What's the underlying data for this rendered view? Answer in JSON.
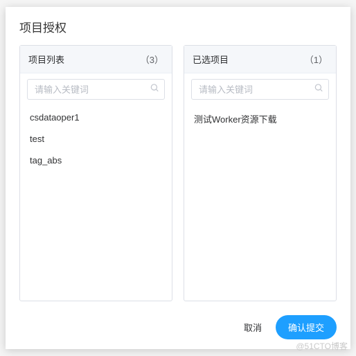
{
  "modal": {
    "title": "项目授权"
  },
  "panels": {
    "available": {
      "title": "项目列表",
      "count": "（3）",
      "search_placeholder": "请输入关键词",
      "items": [
        {
          "label": "csdataoper1"
        },
        {
          "label": "test"
        },
        {
          "label": "tag_abs"
        }
      ]
    },
    "selected": {
      "title": "已选项目",
      "count": "（1）",
      "search_placeholder": "请输入关键词",
      "items": [
        {
          "label": "测试Worker资源下载"
        }
      ]
    }
  },
  "footer": {
    "cancel": "取消",
    "confirm": "确认提交"
  },
  "watermark": "@51CTO博客"
}
